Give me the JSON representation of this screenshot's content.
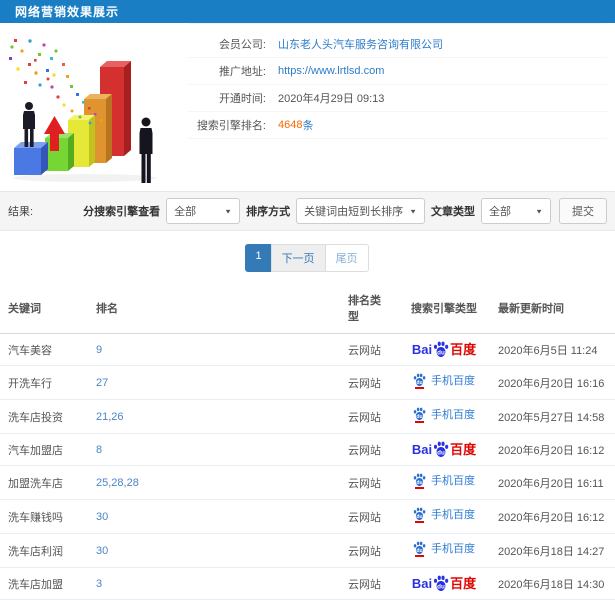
{
  "header": {
    "title": "网络营销效果展示"
  },
  "illustration": {
    "name": "growth-bar-chart-with-businessmen"
  },
  "info": {
    "fields": [
      {
        "label": "会员公司:",
        "value": "山东老人头汽车服务咨询有限公司",
        "style": "link"
      },
      {
        "label": "推广地址:",
        "value": "https://www.lrtlsd.com",
        "style": "link"
      },
      {
        "label": "开通时间:",
        "value": "2020年4月29日 09:13",
        "style": "text"
      },
      {
        "label": "搜索引擎排名:",
        "value": "4648",
        "suffix": "条",
        "style": "highlight"
      }
    ]
  },
  "filters": {
    "result_label": "结果:",
    "engine_label": "分搜索引擎查看",
    "engine_value": "全部",
    "sort_label": "排序方式",
    "sort_value": "关键词由短到长排序",
    "article_label": "文章类型",
    "article_value": "全部",
    "submit_label": "提交"
  },
  "pagination": {
    "current": "1",
    "next": "下一页",
    "last": "尾页"
  },
  "table": {
    "columns": [
      "关键词",
      "排名",
      "排名类型",
      "搜索引擎类型",
      "最新更新时间"
    ],
    "engines": {
      "pc": {
        "bai": "Bai",
        "du": "du",
        "cn": "百度"
      },
      "mobile": {
        "du": "du",
        "text": "手机百度"
      }
    },
    "rows": [
      {
        "keyword": "汽车美容",
        "rank": "9",
        "rank_type": "云网站",
        "engine": "baidu-pc",
        "updated": "2020年6月5日 11:24"
      },
      {
        "keyword": "开洗车行",
        "rank": "27",
        "rank_type": "云网站",
        "engine": "baidu-mobile",
        "updated": "2020年6月20日 16:16"
      },
      {
        "keyword": "洗车店投资",
        "rank": "21,26",
        "rank_type": "云网站",
        "engine": "baidu-mobile",
        "updated": "2020年5月27日 14:58"
      },
      {
        "keyword": "汽车加盟店",
        "rank": "8",
        "rank_type": "云网站",
        "engine": "baidu-pc",
        "updated": "2020年6月20日 16:12"
      },
      {
        "keyword": "加盟洗车店",
        "rank": "25,28,28",
        "rank_type": "云网站",
        "engine": "baidu-mobile",
        "updated": "2020年6月20日 16:11"
      },
      {
        "keyword": "洗车赚钱吗",
        "rank": "30",
        "rank_type": "云网站",
        "engine": "baidu-mobile",
        "updated": "2020年6月20日 16:12"
      },
      {
        "keyword": "洗车店利润",
        "rank": "30",
        "rank_type": "云网站",
        "engine": "baidu-mobile",
        "updated": "2020年6月18日 14:27"
      },
      {
        "keyword": "洗车店加盟",
        "rank": "3",
        "rank_type": "云网站",
        "engine": "baidu-pc",
        "updated": "2020年6月18日 14:30"
      }
    ]
  },
  "colors": {
    "header_bg": "#1a7ec5",
    "link": "#2d7cc9",
    "highlight": "#ff6600",
    "rank_link": "#4a86c6",
    "baidu_blue": "#2932e1",
    "baidu_red": "#e10602",
    "mobile_blue": "#2e7cd4",
    "pagination_active": "#337ab7"
  }
}
